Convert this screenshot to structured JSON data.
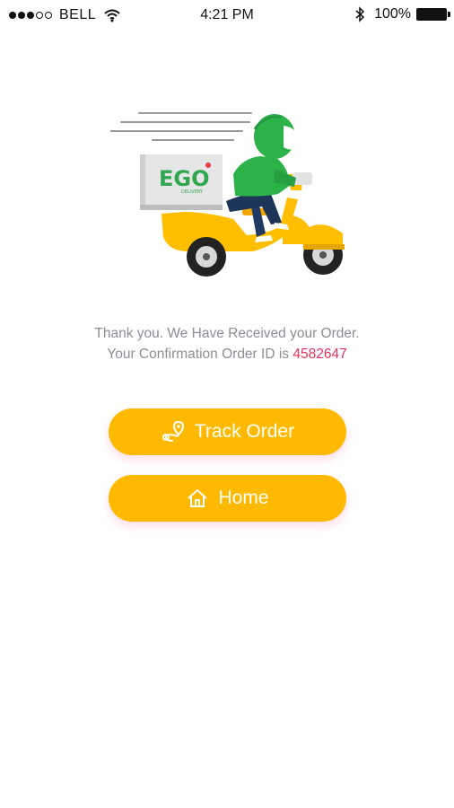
{
  "status_bar": {
    "carrier": "BELL",
    "time": "4:21 PM",
    "battery": "100%",
    "signal_strength": 3,
    "signal_max": 5
  },
  "illustration": {
    "brand_logo": "EGO",
    "brand_tagline": "DELIVERY",
    "colors": {
      "scooter": "#ffbe00",
      "rider": "#2db24a",
      "box": "#e4e4e4"
    }
  },
  "confirmation": {
    "line1": "Thank you. We Have Received your Order.",
    "line2_prefix": "Your Confirmation Order ID is ",
    "order_id": "4582647"
  },
  "buttons": {
    "track_label": "Track Order",
    "home_label": "Home"
  },
  "colors": {
    "accent": "#ffba00",
    "order_id": "#e8305c",
    "muted_text": "#8d8d96"
  },
  "icons": {
    "track": "route-pin-icon",
    "home": "home-icon",
    "wifi": "wifi-icon",
    "bluetooth": "bluetooth-icon",
    "battery": "battery-icon"
  }
}
